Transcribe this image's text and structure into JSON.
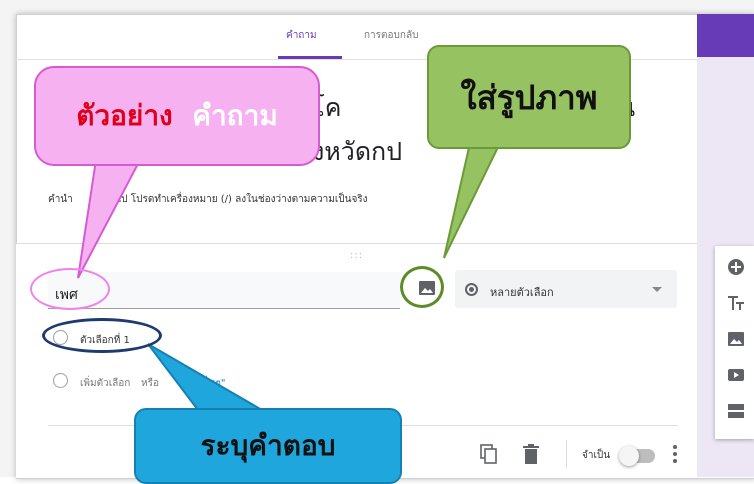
{
  "tabs": {
    "questions": "คำถาม",
    "responses": "การตอบกลับ"
  },
  "form": {
    "title_line1": "พอใจ โค",
    "title_line1_end": "น",
    "title_line2": "วลึก จังหวัดก",
    "title_line2_end": "ป",
    "description_left": "คำนำ",
    "description_right": "ทั่วไป โปรดทำเครื่องหมาย (/) ลงในช่องว่างตามความเป็นจริง"
  },
  "question": {
    "drag_handle": ":::",
    "title_value": "เพศ",
    "type_label": "หลายตัวเลือก",
    "option1": "ตัวเลือกที่ 1",
    "add_option": "เพิ่มตัวเลือก",
    "add_or": "หรือ",
    "add_other": "\"อื่นๆ\"",
    "required_label": "จำเป็น"
  },
  "callouts": {
    "pink_part1": "ตัวอย่าง",
    "pink_part2": "คำถาม",
    "green": "ใส่รูปภาพ",
    "blue": "ระบุคำตอบ"
  },
  "colors": {
    "accent": "#673ab7",
    "pink_bubble": "#f6b1f0",
    "green_bubble": "#96c262",
    "blue_bubble": "#1fa6dc"
  },
  "icons": [
    "image-icon",
    "radio-icon",
    "dropdown-caret-icon",
    "copy-icon",
    "trash-icon",
    "more-vert-icon",
    "add-circle-icon",
    "text-title-icon",
    "image-add-icon",
    "video-icon",
    "section-icon"
  ]
}
